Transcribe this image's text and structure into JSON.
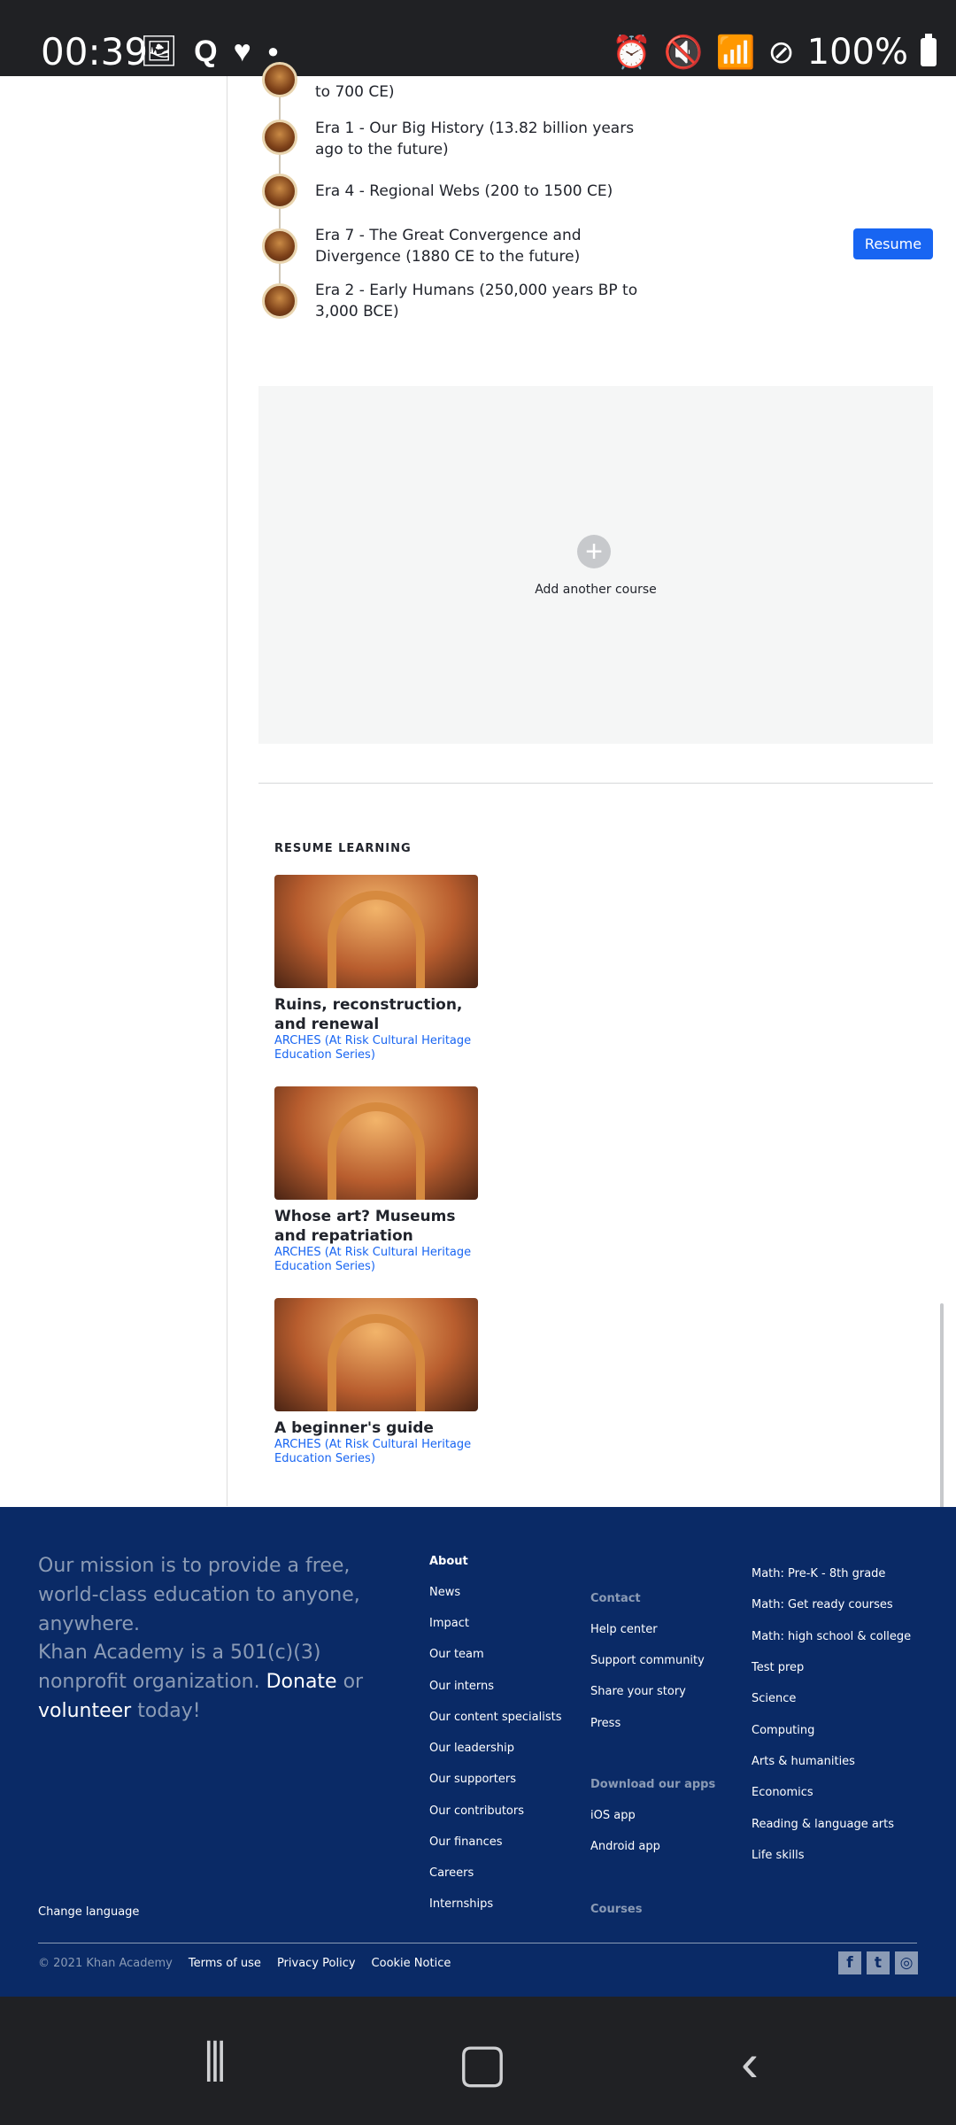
{
  "status_bar": {
    "time": "00:39",
    "left_icons": [
      "image-icon",
      "q-icon",
      "heart-icon",
      "dot-icon"
    ],
    "right_icons": [
      "alarm-icon",
      "mute-icon",
      "wifi-icon",
      "block-icon"
    ],
    "battery": "100%"
  },
  "eras": [
    {
      "label": "to 700 CE)"
    },
    {
      "label": "Era 1 - Our Big History (13.82 billion years ago to the future)"
    },
    {
      "label": "Era 4 - Regional Webs (200 to 1500 CE)"
    },
    {
      "label": "Era 7 - The Great Convergence and Divergence (1880 CE to the future)"
    },
    {
      "label": "Era 2 - Early Humans (250,000 years BP to 3,000 BCE)"
    }
  ],
  "resume_button": "Resume",
  "add_course": {
    "icon": "+",
    "label": "Add another course"
  },
  "resume_learning": {
    "title": "RESUME LEARNING",
    "cards": [
      {
        "title": "Ruins, reconstruction, and renewal",
        "subtitle": "ARCHES (At Risk Cultural Heritage Education Series)"
      },
      {
        "title": "Whose art? Museums and repatriation",
        "subtitle": "ARCHES (At Risk Cultural Heritage Education Series)"
      },
      {
        "title": "A beginner's guide",
        "subtitle": "ARCHES (At Risk Cultural Heritage Education Series)"
      }
    ]
  },
  "footer": {
    "mission": "Our mission is to provide a free, world-class education to anyone, anywhere.",
    "nonprofit_prefix": "Khan Academy is a 501(c)(3) nonprofit organization.",
    "donate": "Donate",
    "or": "or",
    "volunteer": "volunteer",
    "today": "today!",
    "about": {
      "heading": "About",
      "items": [
        "News",
        "Impact",
        "Our team",
        "Our interns",
        "Our content specialists",
        "Our leadership",
        "Our supporters",
        "Our contributors",
        "Our finances",
        "Careers",
        "Internships"
      ]
    },
    "contact": {
      "heading": "Contact",
      "items": [
        "Help center",
        "Support community",
        "Share your story",
        "Press"
      ]
    },
    "apps": {
      "heading": "Download our apps",
      "items": [
        "iOS app",
        "Android app"
      ]
    },
    "courses_heading": "Courses",
    "subjects": [
      "Math: Pre-K - 8th grade",
      "Math: Get ready courses",
      "Math: high school & college",
      "Test prep",
      "Science",
      "Computing",
      "Arts & humanities",
      "Economics",
      "Reading & language arts",
      "Life skills"
    ],
    "change_language": "Change language",
    "copyright": "© 2021 Khan Academy",
    "terms": "Terms of use",
    "privacy": "Privacy Policy",
    "cookie": "Cookie Notice",
    "social": [
      "facebook-icon",
      "twitter-icon",
      "instagram-icon"
    ]
  },
  "nav_bar": {
    "buttons": [
      "recents-icon",
      "home-icon",
      "back-icon"
    ]
  }
}
